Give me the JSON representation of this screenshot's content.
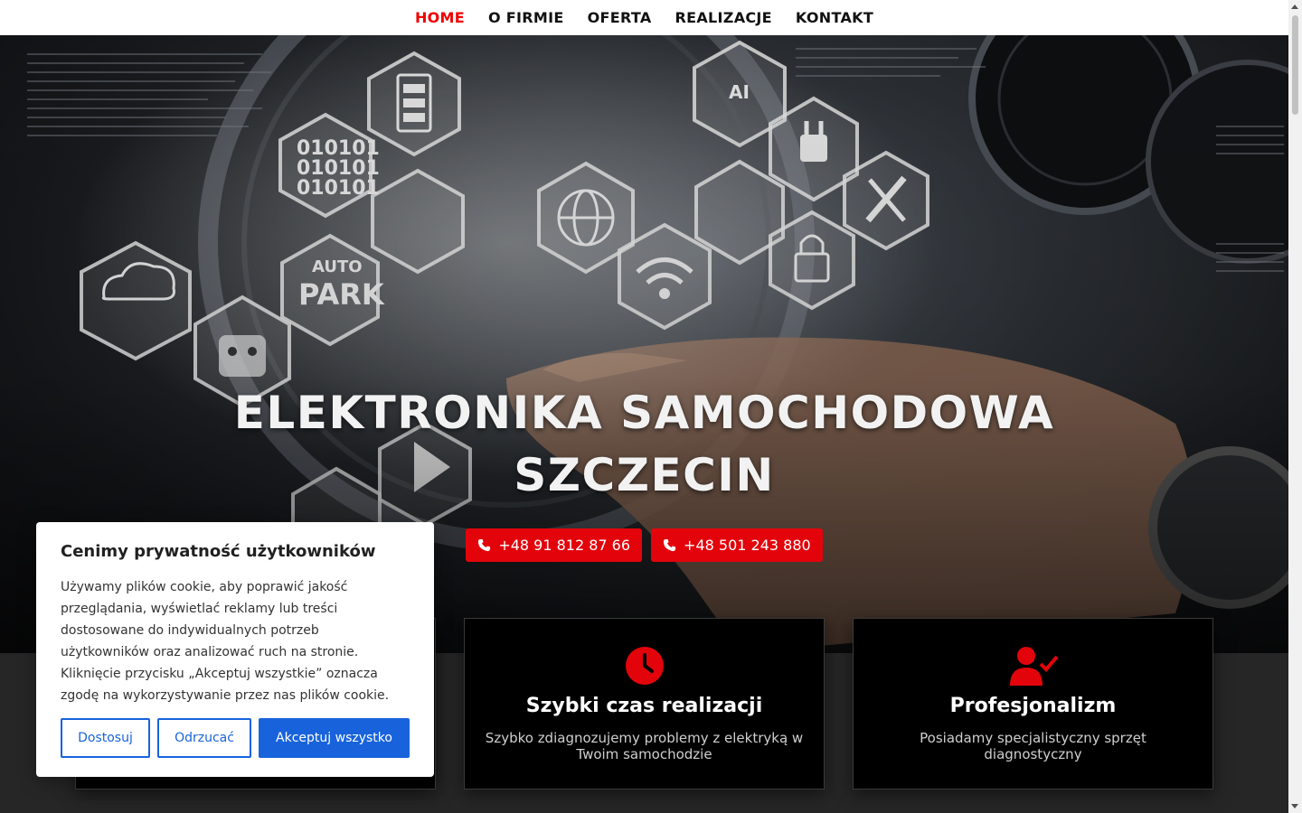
{
  "nav": {
    "items": [
      {
        "label": "HOME",
        "active": true
      },
      {
        "label": "O FIRMIE"
      },
      {
        "label": "OFERTA"
      },
      {
        "label": "REALIZACJE"
      },
      {
        "label": "KONTAKT"
      }
    ]
  },
  "hero": {
    "title_line1": "ELEKTRONIKA SAMOCHODOWA",
    "title_line2": "SZCZECIN",
    "phones": [
      "+48 91 812 87 66",
      "+48 501 243 880"
    ],
    "phone_icon": "phone-icon",
    "hex_labels": {
      "binary": "010101",
      "auto": "AUTO",
      "park": "PARK",
      "ai": "AI"
    }
  },
  "features": [
    {
      "icon": "clock-icon",
      "title": "Szybki czas realizacji",
      "text": "Szybko zdiagnozujemy problemy z elektryką w Twoim samochodzie"
    },
    {
      "icon": "user-check-icon",
      "title": "Profesjonalizm",
      "text": "Posiadamy specjalistyczny sprzęt diagnostyczny"
    }
  ],
  "cookie": {
    "title": "Cenimy prywatność użytkowników",
    "text": "Używamy plików cookie, aby poprawić jakość przeglądania, wyświetlać reklamy lub treści dostosowane do indywidualnych potrzeb użytkowników oraz analizować ruch na stronie. Kliknięcie przycisku „Akceptuj wszystkie” oznacza zgodę na wykorzystywanie przez nas plików cookie.",
    "customize": "Dostosuj",
    "reject": "Odrzucać",
    "accept": "Akceptuj wszystko"
  },
  "colors": {
    "accent": "#e3040b",
    "cookie_blue": "#1863dc",
    "nav_active": "#e00000"
  }
}
